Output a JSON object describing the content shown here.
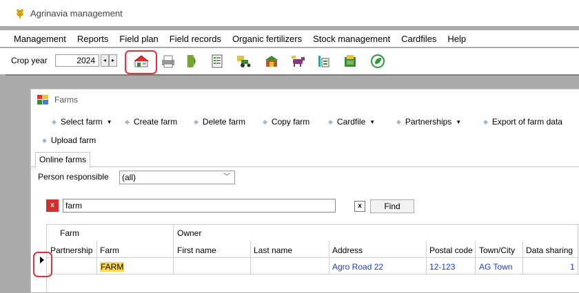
{
  "window": {
    "title": "Agrinavia management"
  },
  "menu": [
    "Management",
    "Reports",
    "Field plan",
    "Field records",
    "Organic fertilizers",
    "Stock management",
    "Cardfiles",
    "Help"
  ],
  "toolbar": {
    "crop_year_label": "Crop year",
    "crop_year_value": "2024",
    "spin_left": "◂",
    "spin_right": "▸",
    "icons": [
      "farms-icon",
      "printer-icon",
      "field-icon",
      "report-icon",
      "machinery-icon",
      "storage-icon",
      "livestock-icon",
      "stock-icon",
      "cardfile-icon",
      "organic-icon"
    ]
  },
  "farms_window": {
    "title": "Farms",
    "actions": [
      {
        "label": "Select farm",
        "dropdown": true
      },
      {
        "label": "Create farm",
        "dropdown": false
      },
      {
        "label": "Delete farm",
        "dropdown": false
      },
      {
        "label": "Copy farm",
        "dropdown": false
      },
      {
        "label": "Cardfile",
        "dropdown": true
      },
      {
        "label": "Partnerships",
        "dropdown": true
      },
      {
        "label": "Export of farm data",
        "dropdown": false
      },
      {
        "label": "Upload farm",
        "dropdown": false
      }
    ],
    "tab": "Online farms",
    "person_label": "Person responsible",
    "person_value": "(all)",
    "clear_label": "x",
    "search_value": "farm",
    "search_clear": "x",
    "find_label": "Find",
    "grid": {
      "group_farm": "Farm",
      "group_owner": "Owner",
      "columns": [
        "Partnership",
        "Farm",
        "First name",
        "Last name",
        "Address",
        "Postal code",
        "Town/City",
        "Data sharing"
      ],
      "rows": [
        {
          "partnership": "",
          "farm": "FARM",
          "first_name": "",
          "last_name": "",
          "address": "Agro Road 22",
          "postal_code": "12-123",
          "town": "AG Town",
          "data_sharing": "1"
        }
      ]
    }
  },
  "colors": {
    "highlight_red": "#e62e3d",
    "link_blue": "#1f3fbf",
    "match_yellow": "#ffd84d"
  }
}
